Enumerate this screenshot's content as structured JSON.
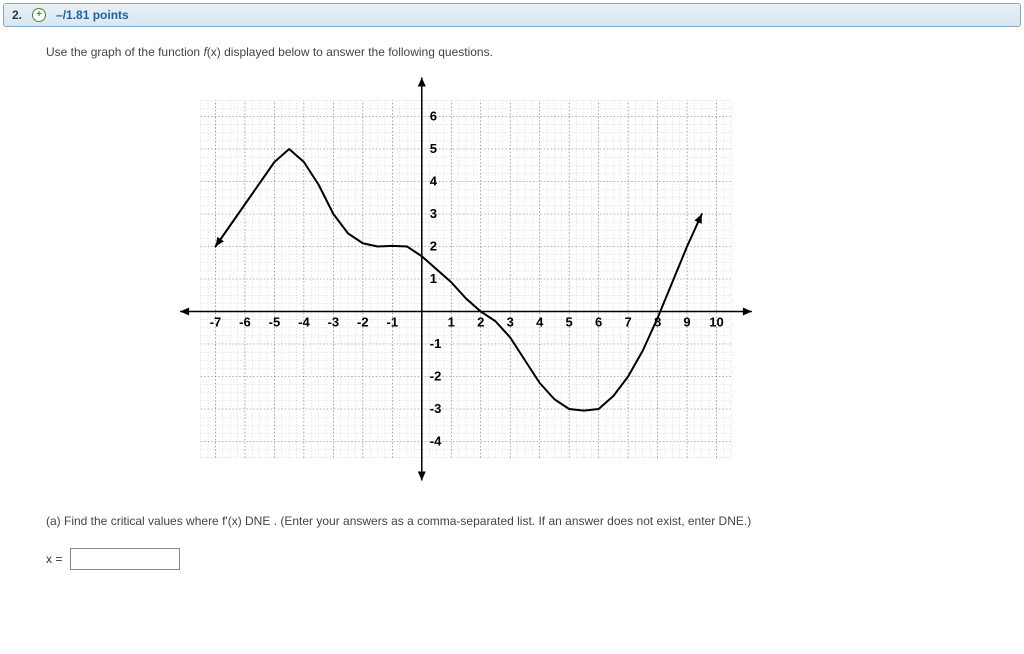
{
  "header": {
    "number": "2.",
    "points": "–/1.81 points"
  },
  "question": {
    "prefix": "Use the graph of the function ",
    "fn": "f",
    "fnarg": "(x)",
    "suffix": " displayed below to answer the following questions."
  },
  "chart_data": {
    "type": "line",
    "xlabel": "",
    "ylabel": "",
    "xlim": [
      -8,
      11
    ],
    "ylim": [
      -5,
      7
    ],
    "x_major": [
      -7,
      -6,
      -5,
      -4,
      -3,
      -2,
      -1,
      1,
      2,
      3,
      4,
      5,
      6,
      7,
      8,
      9,
      10
    ],
    "y_major": [
      -4,
      -3,
      -2,
      -1,
      1,
      2,
      3,
      4,
      5,
      6
    ],
    "x_tick_labels": [
      "-7",
      "-6",
      "-5",
      "-4",
      "-3",
      "-2",
      "-1",
      "1",
      "2",
      "3",
      "4",
      "5",
      "6",
      "7",
      "8",
      "9",
      "10"
    ],
    "y_tick_labels": [
      "-4",
      "-3",
      "-2",
      "-1",
      "1",
      "2",
      "3",
      "4",
      "5",
      "6"
    ],
    "grid": {
      "major": true,
      "minor": true
    },
    "series": [
      {
        "name": "f(x)",
        "points": [
          {
            "x": -7,
            "y": 2
          },
          {
            "x": -6,
            "y": 3.3
          },
          {
            "x": -5,
            "y": 4.6
          },
          {
            "x": -4.5,
            "y": 5
          },
          {
            "x": -4,
            "y": 4.6
          },
          {
            "x": -3.5,
            "y": 3.9
          },
          {
            "x": -3,
            "y": 3
          },
          {
            "x": -2.5,
            "y": 2.4
          },
          {
            "x": -2,
            "y": 2.1
          },
          {
            "x": -1.5,
            "y": 2
          },
          {
            "x": -1,
            "y": 2.02
          },
          {
            "x": -0.5,
            "y": 2
          },
          {
            "x": 0,
            "y": 1.7
          },
          {
            "x": 0.5,
            "y": 1.3
          },
          {
            "x": 1,
            "y": 0.9
          },
          {
            "x": 1.5,
            "y": 0.4
          },
          {
            "x": 2,
            "y": 0
          },
          {
            "x": 2.5,
            "y": -0.3
          },
          {
            "x": 3,
            "y": -0.8
          },
          {
            "x": 3.5,
            "y": -1.5
          },
          {
            "x": 4,
            "y": -2.2
          },
          {
            "x": 4.5,
            "y": -2.7
          },
          {
            "x": 5,
            "y": -3
          },
          {
            "x": 5.5,
            "y": -3.05
          },
          {
            "x": 6,
            "y": -3
          },
          {
            "x": 6.5,
            "y": -2.6
          },
          {
            "x": 7,
            "y": -2
          },
          {
            "x": 7.5,
            "y": -1.2
          },
          {
            "x": 8,
            "y": -0.2
          },
          {
            "x": 8.5,
            "y": 0.9
          },
          {
            "x": 9,
            "y": 2
          },
          {
            "x": 9.5,
            "y": 3
          }
        ],
        "left_arrow": true,
        "right_arrow": true
      }
    ]
  },
  "sub": {
    "label": "(a) Find the critical values where  f'(x) DNE . (Enter your answers as a comma-separated list. If an answer does not exist, enter DNE.)"
  },
  "answer": {
    "label": "x =",
    "value": ""
  }
}
